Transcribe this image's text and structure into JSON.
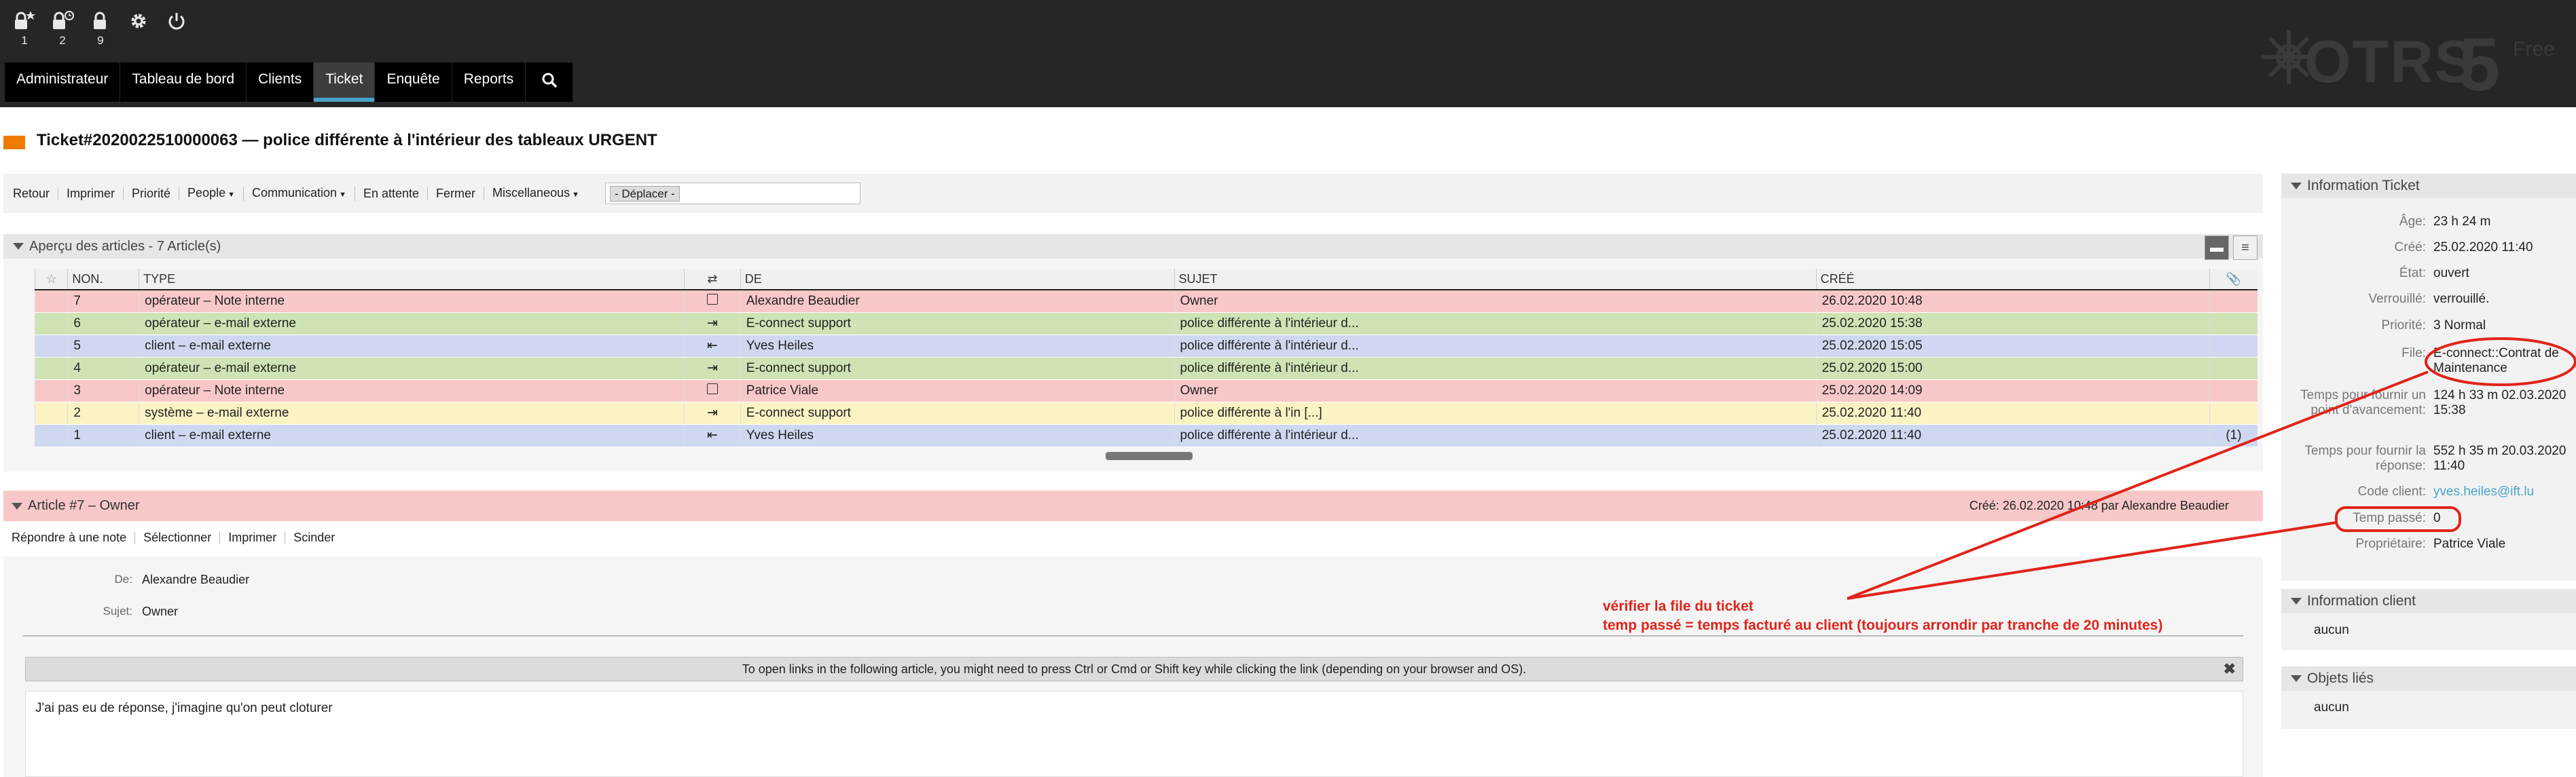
{
  "header": {
    "toolbar": [
      {
        "icon": "lock-star-icon",
        "count": "1"
      },
      {
        "icon": "lock-clock-icon",
        "count": "2"
      },
      {
        "icon": "lock-icon",
        "count": "9"
      },
      {
        "icon": "gear-icon",
        "count": ""
      },
      {
        "icon": "power-icon",
        "count": ""
      }
    ],
    "nav": [
      {
        "label": "Administrateur"
      },
      {
        "label": "Tableau de bord"
      },
      {
        "label": "Clients"
      },
      {
        "label": "Ticket",
        "active": true
      },
      {
        "label": "Enquête"
      },
      {
        "label": "Reports"
      }
    ],
    "search_icon": "search-icon",
    "logo": {
      "text": "OTRS",
      "version": "5",
      "edition": "Free"
    }
  },
  "ticket": {
    "title": "Ticket#2020022510000063 — police différente à l'intérieur des tableaux URGENT",
    "priority_color": "#f07a00"
  },
  "actions": [
    {
      "label": "Retour"
    },
    {
      "label": "Imprimer"
    },
    {
      "label": "Priorité"
    },
    {
      "label": "People",
      "dropdown": true
    },
    {
      "label": "Communication",
      "dropdown": true
    },
    {
      "label": "En attente"
    },
    {
      "label": "Fermer"
    },
    {
      "label": "Miscellaneous",
      "dropdown": true
    }
  ],
  "move_select": {
    "value": "- Déplacer -"
  },
  "articles_widget": {
    "title": "Aperçu des articles - 7 Article(s)",
    "columns": [
      "NON.",
      "TYPE",
      "DE",
      "SUJET",
      "CRÉÉ"
    ],
    "rows": [
      {
        "no": "7",
        "type": "opérateur – Note interne",
        "from": "Alexandre Beaudier",
        "subject": "Owner",
        "created": "26.02.2020 10:48",
        "kind": "internal",
        "attach": ""
      },
      {
        "no": "6",
        "type": "opérateur – e-mail externe",
        "from": "E-connect support",
        "subject": "police différente à l'intérieur d...",
        "created": "25.02.2020 15:38",
        "kind": "ext-out",
        "attach": ""
      },
      {
        "no": "5",
        "type": "client – e-mail externe",
        "from": "Yves Heiles",
        "subject": "police différente à l'intérieur d...",
        "created": "25.02.2020 15:05",
        "kind": "ext-in",
        "attach": ""
      },
      {
        "no": "4",
        "type": "opérateur – e-mail externe",
        "from": "E-connect support",
        "subject": "police différente à l'intérieur d...",
        "created": "25.02.2020 15:00",
        "kind": "ext-out",
        "attach": ""
      },
      {
        "no": "3",
        "type": "opérateur – Note interne",
        "from": "Patrice Viale",
        "subject": "Owner",
        "created": "25.02.2020 14:09",
        "kind": "internal",
        "attach": ""
      },
      {
        "no": "2",
        "type": "système – e-mail externe",
        "from": "E-connect support",
        "subject": "police différente à l'in [...]",
        "created": "25.02.2020 11:40",
        "kind": "system",
        "attach": ""
      },
      {
        "no": "1",
        "type": "client – e-mail externe",
        "from": "Yves Heiles",
        "subject": "police différente à l'intérieur d...",
        "created": "25.02.2020 11:40",
        "kind": "ext-in",
        "attach": "(1)"
      }
    ]
  },
  "article": {
    "header": "Article #7 – Owner",
    "created_line": "Créé: 26.02.2020 10:48 par Alexandre Beaudier",
    "actions": [
      {
        "label": "Répondre à une note"
      },
      {
        "label": "Sélectionner"
      },
      {
        "label": "Imprimer"
      },
      {
        "label": "Scinder"
      }
    ],
    "from_label": "De:",
    "from_value": "Alexandre Beaudier",
    "subject_label": "Sujet:",
    "subject_value": "Owner",
    "notice": "To open links in the following article, you might need to press Ctrl or Cmd or Shift key while clicking the link (depending on your browser and OS).",
    "body": "J'ai pas eu de réponse, j'imagine qu'on peut cloturer"
  },
  "sidebar": {
    "ticket_info": {
      "title": "Information Ticket",
      "fields": [
        {
          "label": "Âge:",
          "value": "23 h 24 m"
        },
        {
          "label": "Créé:",
          "value": "25.02.2020 11:40"
        },
        {
          "label": "État:",
          "value": "ouvert"
        },
        {
          "label": "Verrouillé:",
          "value": "verrouillé."
        },
        {
          "label": "Priorité:",
          "value": "3 Normal"
        },
        {
          "label": "File:",
          "value": "E-connect::Contrat de Maintenance"
        },
        {
          "label": "Temps pour fournir un point d'avancement:",
          "value": "124 h 33 m 02.03.2020 15:38"
        },
        {
          "label": "Temps pour fournir la réponse:",
          "value": "552 h 35 m 20.03.2020 11:40"
        },
        {
          "label": "Code client:",
          "value": "yves.heiles@ift.lu"
        },
        {
          "label": "Temp passé:",
          "value": "0"
        },
        {
          "label": "Propriétaire:",
          "value": "Patrice Viale"
        }
      ]
    },
    "client_info": {
      "title": "Information client",
      "value": "aucun"
    },
    "linked_objects": {
      "title": "Objets liés",
      "value": "aucun"
    }
  },
  "annotation": {
    "line1": "vérifier la file du ticket",
    "line2": "temp passé = temps facturé au client (toujours arrondir par tranche de 20 minutes)",
    "color": "#e0241a"
  }
}
